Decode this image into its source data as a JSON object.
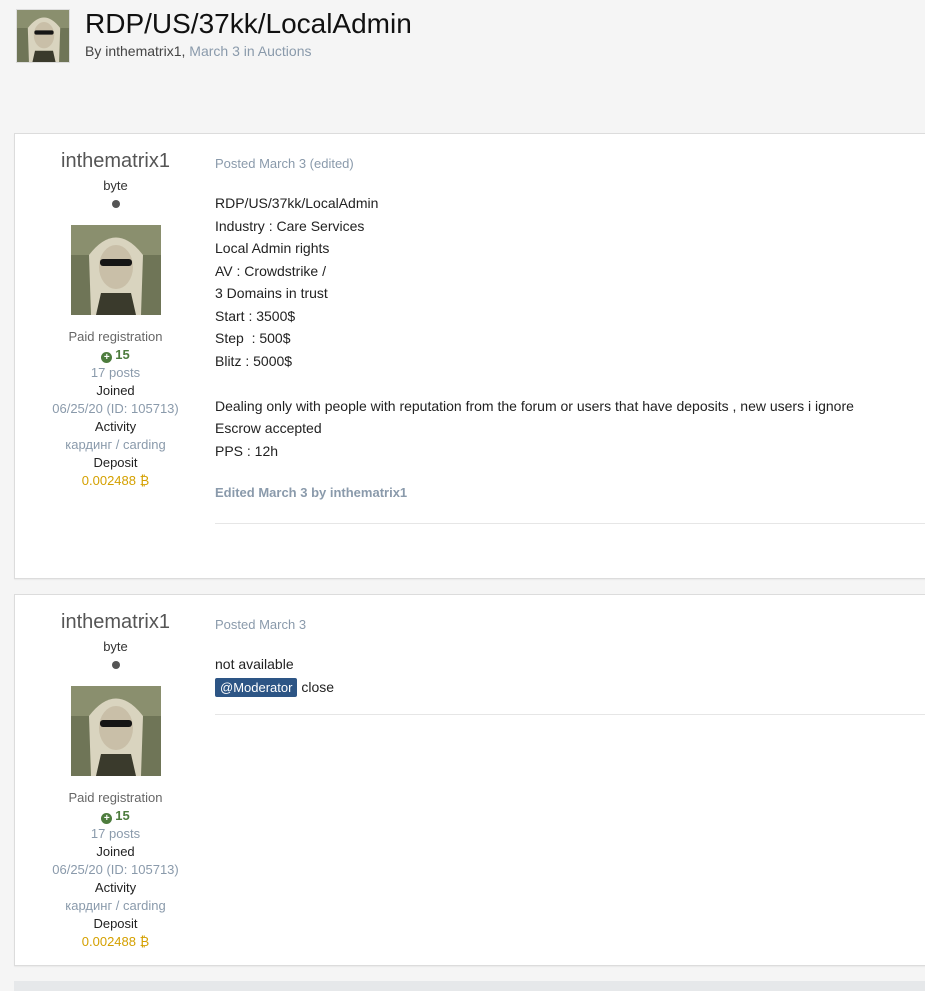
{
  "topic": {
    "title": "RDP/US/37kk/LocalAdmin",
    "by_prefix": "By",
    "author": "inthematrix1",
    "comma": ",",
    "date": "March 3",
    "in_word": "in",
    "forum": "Auctions"
  },
  "posts": [
    {
      "author": {
        "name": "inthematrix1",
        "rank": "byte",
        "group": "Paid registration",
        "reputation": "15",
        "posts": "17 posts",
        "joined_label": "Joined",
        "joined_value": "06/25/20 (ID: 105713)",
        "activity_label": "Activity",
        "activity_value": "кардинг / carding",
        "deposit_label": "Deposit",
        "deposit_value": "0.002488 ₿"
      },
      "meta": "Posted March 3 (edited)",
      "lines": [
        "RDP/US/37kk/LocalAdmin",
        "Industry : Care Services",
        "Local Admin rights",
        "AV : Crowdstrike /",
        "3 Domains in trust",
        "Start : 3500$",
        "Step  : 500$",
        "Blitz : 5000$",
        "",
        "Dealing only with people with reputation from the forum or users that have deposits , new users i ignore",
        "Escrow accepted",
        "PPS : 12h"
      ],
      "edited": "Edited March 3 by inthematrix1"
    },
    {
      "author": {
        "name": "inthematrix1",
        "rank": "byte",
        "group": "Paid registration",
        "reputation": "15",
        "posts": "17 posts",
        "joined_label": "Joined",
        "joined_value": "06/25/20 (ID: 105713)",
        "activity_label": "Activity",
        "activity_value": "кардинг / carding",
        "deposit_label": "Deposit",
        "deposit_value": "0.002488 ₿"
      },
      "meta": "Posted March 3",
      "line1": "not available",
      "mention": "@Moderator",
      "after_mention": "close"
    }
  ],
  "colors": {
    "link_muted": "#8a9aab",
    "reputation": "#4d7c3d",
    "deposit": "#d4a000",
    "mention_bg": "#2d5585"
  }
}
